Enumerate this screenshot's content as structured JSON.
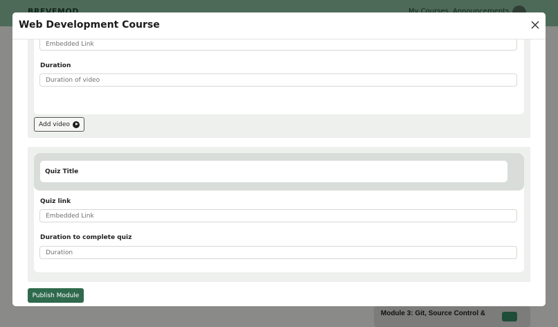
{
  "background": {
    "logo": "BREVEMOD",
    "nav": [
      "My Courses",
      "Announcements"
    ],
    "card_title": "Module 3: Git, Source Control &",
    "card_button": "+"
  },
  "modal": {
    "title": "Web Development Course",
    "close_icon": "close-icon"
  },
  "video_section": {
    "link_placeholder": "Embedded Link",
    "duration_label": "Duration",
    "duration_placeholder": "Duration of video",
    "add_video_label": "Add video",
    "add_video_icon": "play-circle-icon"
  },
  "quiz_section": {
    "title": "Quiz Title",
    "link_label": "Quiz link",
    "link_placeholder": "Embedded Link",
    "duration_label": "Duration to complete quiz",
    "duration_placeholder": "Duration"
  },
  "publish_label": "Publish Module",
  "colors": {
    "accent": "#2f6a4d",
    "section_bg": "#eef0ed",
    "overlay": "#8a8a88"
  }
}
